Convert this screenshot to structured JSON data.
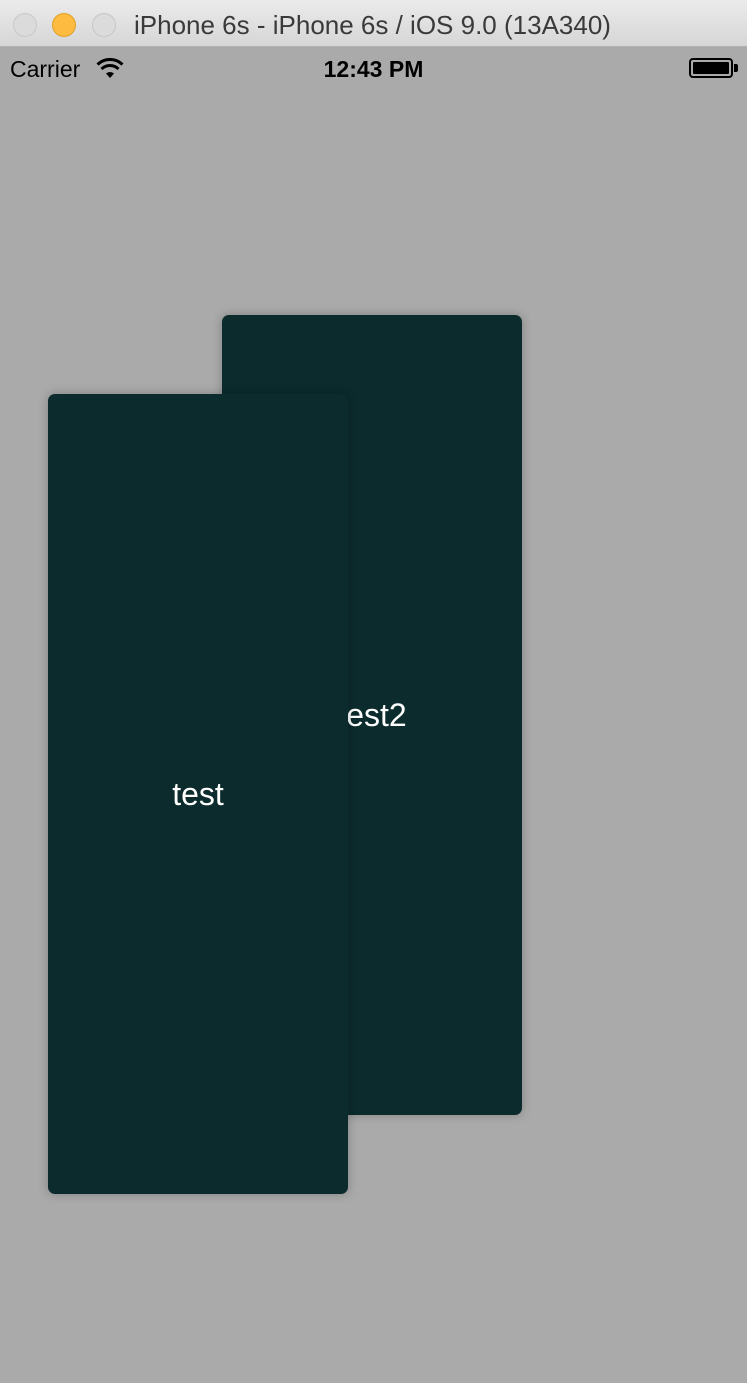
{
  "window": {
    "title": "iPhone 6s - iPhone 6s / iOS 9.0 (13A340)"
  },
  "status_bar": {
    "carrier": "Carrier",
    "time": "12:43 PM",
    "wifi_icon": "wifi-icon",
    "battery_icon": "battery-icon"
  },
  "cards": {
    "front": {
      "label": "test"
    },
    "back": {
      "label": "test2"
    }
  },
  "colors": {
    "background": "#aaaaaa",
    "card": "#0b2b2d",
    "card_text": "#ffffff"
  }
}
